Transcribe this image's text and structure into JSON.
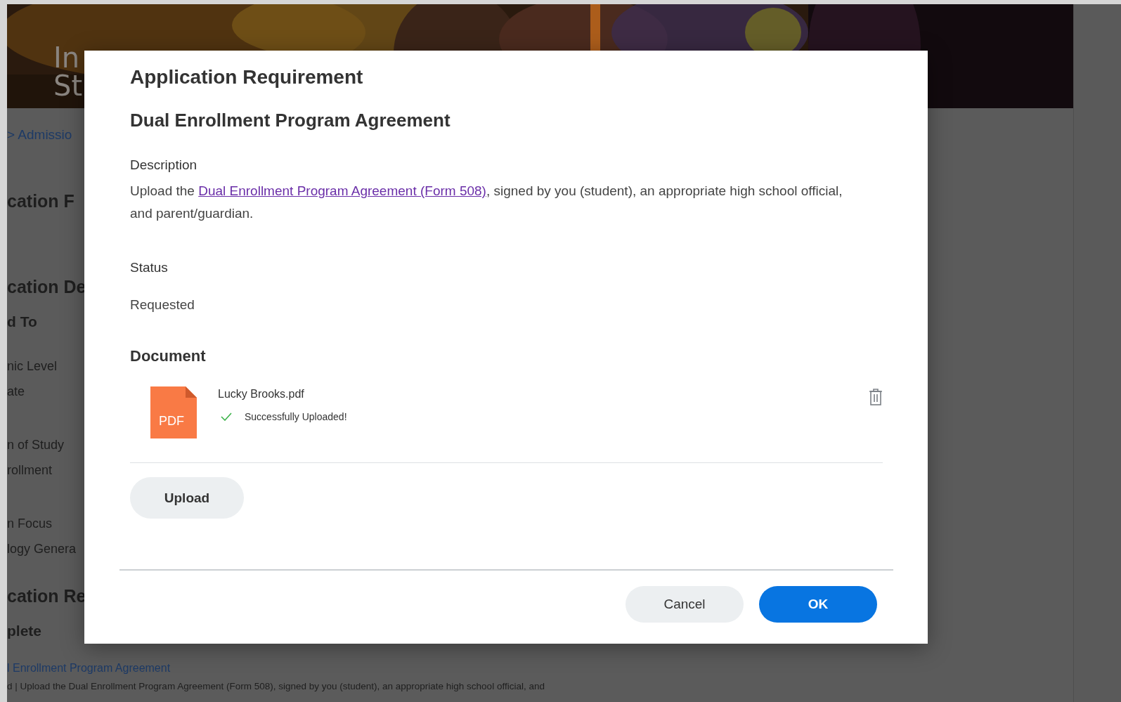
{
  "banner": {
    "title_lines": [
      "In",
      "St"
    ]
  },
  "background_page": {
    "breadcrumb": "> Admissio",
    "sections": [
      {
        "heading": "cation F"
      },
      {
        "heading": "cation De",
        "rows": [
          {
            "kind": "subheading",
            "text": "d To"
          },
          {
            "kind": "field",
            "text": "nic Level"
          },
          {
            "kind": "value",
            "text": "ate"
          },
          {
            "kind": "field",
            "text": "n of Study"
          },
          {
            "kind": "value",
            "text": "rollment"
          },
          {
            "kind": "field",
            "text": "n Focus"
          },
          {
            "kind": "value",
            "text": "logy Genera"
          }
        ]
      },
      {
        "heading": "cation Re",
        "rows": [
          {
            "kind": "subheading",
            "text": "plete"
          }
        ]
      }
    ],
    "requirement_link": "l Enrollment Program Agreement",
    "requirement_text": "d | Upload the Dual Enrollment Program Agreement (Form 508), signed by you (student), an appropriate high school official, and"
  },
  "dialog": {
    "title": "Application Requirement",
    "subtitle": "Dual Enrollment Program Agreement",
    "description": {
      "label": "Description",
      "before": "Upload the ",
      "link": "Dual Enrollment Program Agreement (Form 508)",
      "after": ", signed by you (student), an appropriate high school official, and parent/guardian."
    },
    "status": {
      "label": "Status",
      "value": "Requested"
    },
    "document": {
      "label": "Document",
      "file_type": "PDF",
      "file_name": "Lucky Brooks.pdf",
      "upload_status": "Successfully Uploaded!"
    },
    "upload_button": "Upload",
    "buttons": [
      {
        "label": "Cancel",
        "kind": "secondary"
      },
      {
        "label": "OK",
        "kind": "primary"
      }
    ]
  }
}
